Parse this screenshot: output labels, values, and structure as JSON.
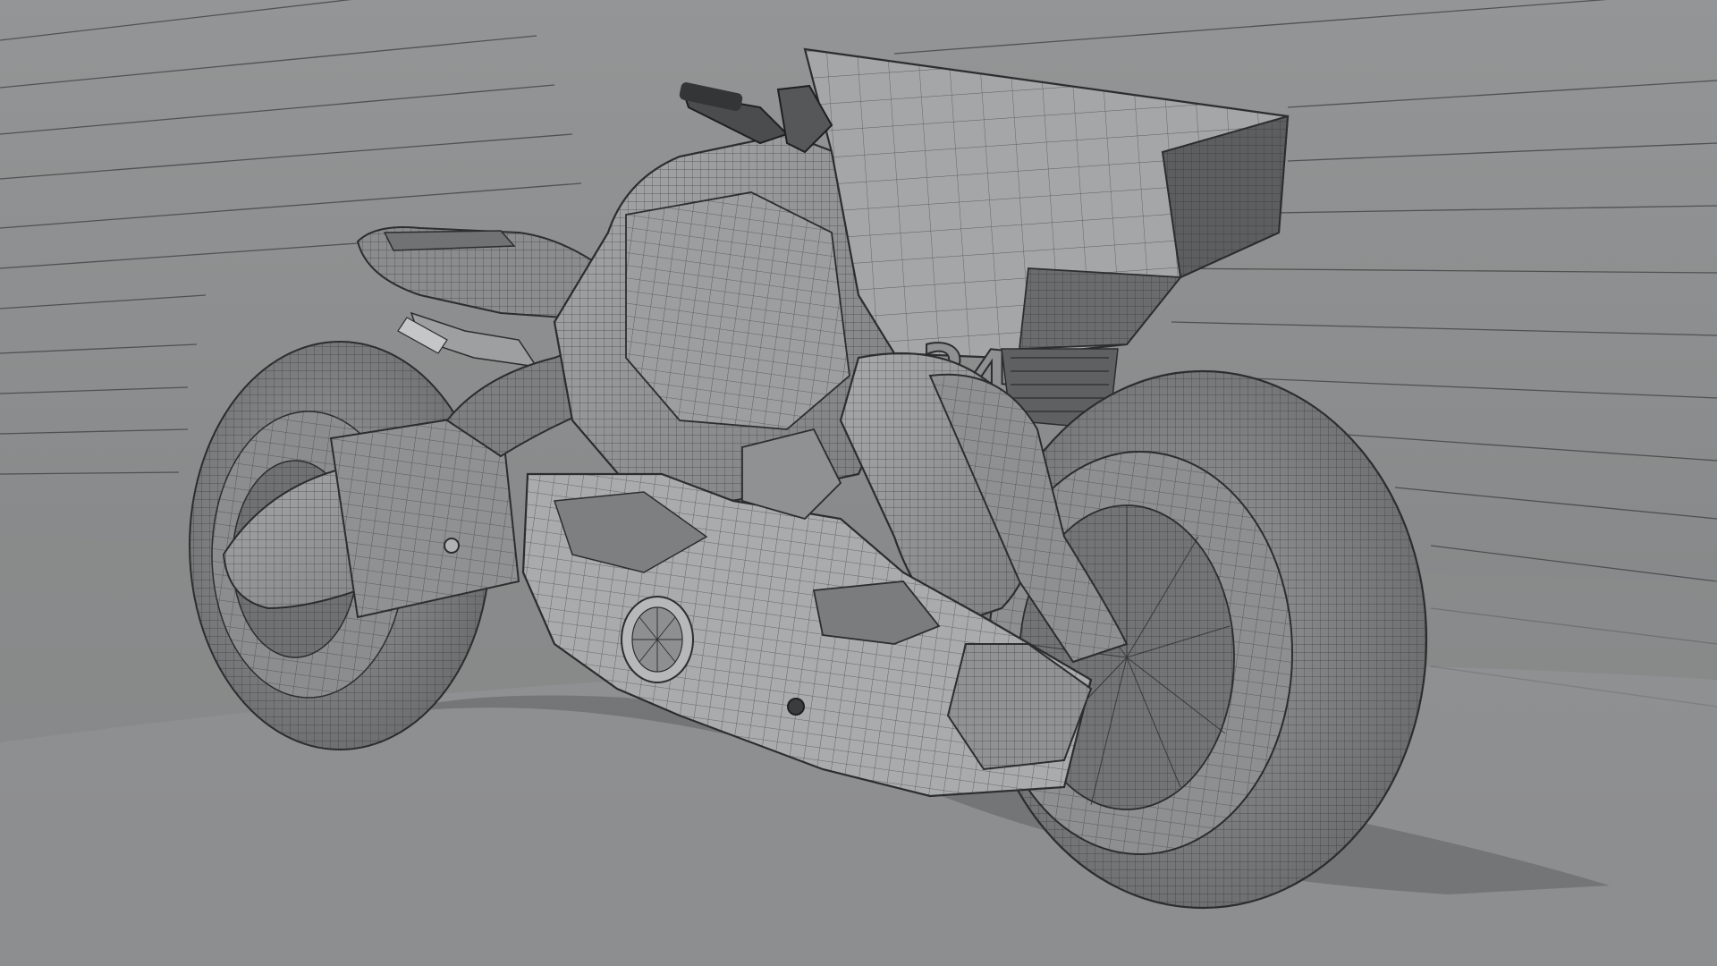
{
  "scene": {
    "subject": "wireframe-motorcycle",
    "decal_number": "24",
    "colors": {
      "backdrop_top": "#8f9192",
      "backdrop_bottom": "#7d7f80",
      "floor": "#8a8c8d",
      "shadow": "#6e7071",
      "body": "#9a9c9d",
      "body_dark": "#6f7172",
      "body_light": "#b9bbbc",
      "wire": "#2b2d2e",
      "tire": "#808283",
      "decal": "#4a4c4d"
    }
  }
}
